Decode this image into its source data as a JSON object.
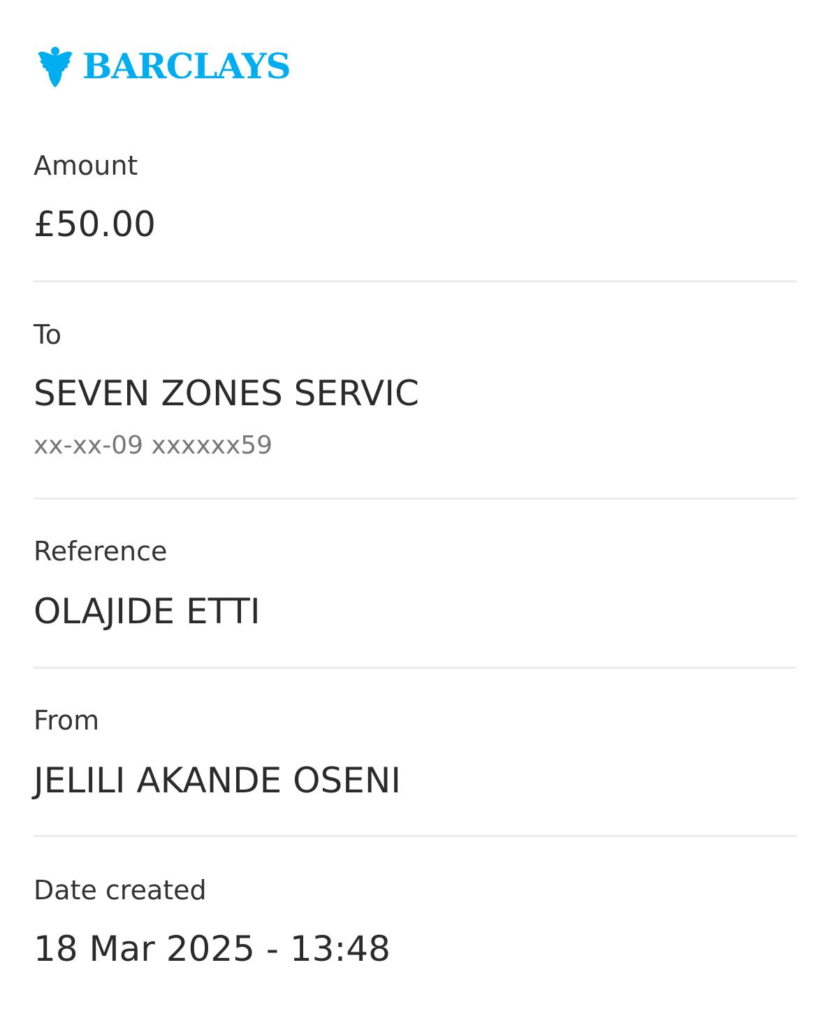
{
  "brand": {
    "name": "BARCLAYS",
    "logo_icon": "eagle-icon",
    "color": "#00aeef"
  },
  "receipt": {
    "amount": {
      "label": "Amount",
      "value": "£50.00"
    },
    "to": {
      "label": "To",
      "value": "SEVEN ZONES SERVIC",
      "account": "xx-xx-09 xxxxxx59"
    },
    "reference": {
      "label": "Reference",
      "value": "OLAJIDE ETTI"
    },
    "from": {
      "label": "From",
      "value": "JELILI AKANDE OSENI"
    },
    "date_created": {
      "label": "Date created",
      "value": "18 Mar 2025 - 13:48"
    }
  },
  "colors": {
    "label_text": "#333333",
    "value_text": "#2b2b2b",
    "muted_text": "#777777",
    "divider": "#ececec"
  }
}
